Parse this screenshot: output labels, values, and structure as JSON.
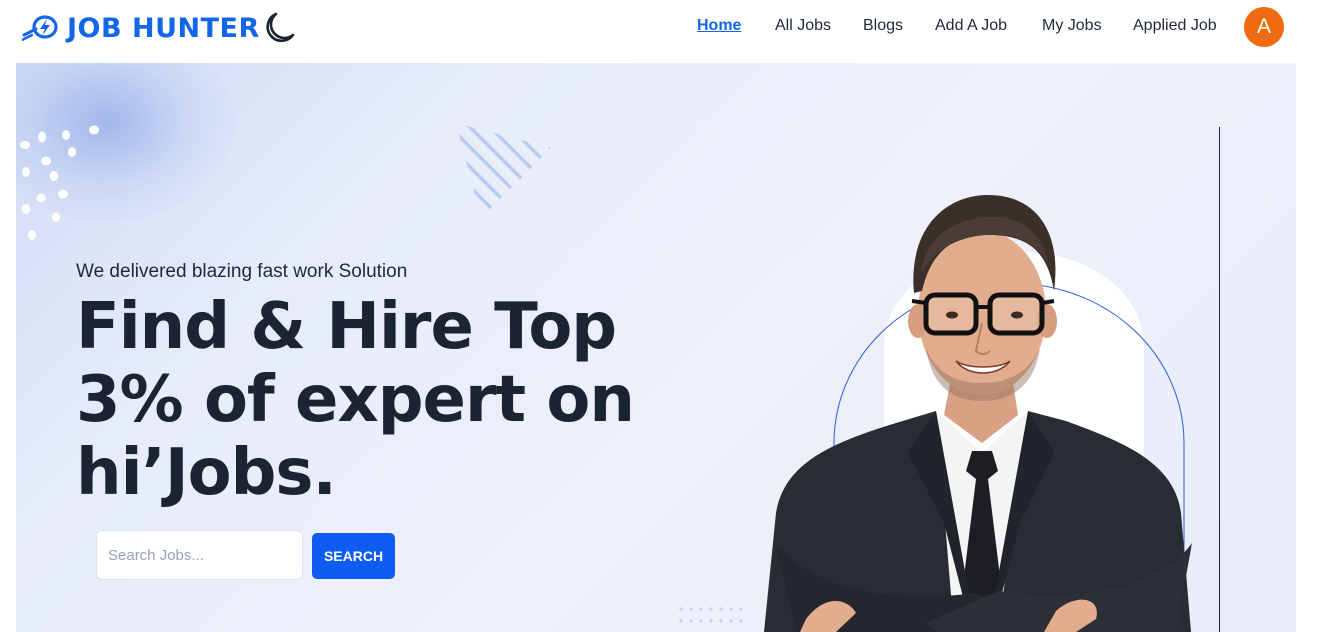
{
  "brand": {
    "name": "JOB HUNTER",
    "color": "#1267e8"
  },
  "nav": {
    "links": [
      {
        "label": "Home",
        "active": true
      },
      {
        "label": "All Jobs",
        "active": false
      },
      {
        "label": "Blogs",
        "active": false
      },
      {
        "label": "Add A Job",
        "active": false
      },
      {
        "label": "My Jobs",
        "active": false
      },
      {
        "label": "Applied Job",
        "active": false
      }
    ],
    "avatar_initial": "A",
    "avatar_color": "#f06b0f"
  },
  "hero": {
    "tagline": "We delivered blazing fast work Solution",
    "headline_lines": [
      "Find & Hire Top",
      "3% of expert on",
      "hi’Jobs."
    ],
    "search": {
      "placeholder": "Search Jobs...",
      "value": "",
      "button_label": "SEARCH",
      "button_color": "#0e5cf2"
    }
  }
}
